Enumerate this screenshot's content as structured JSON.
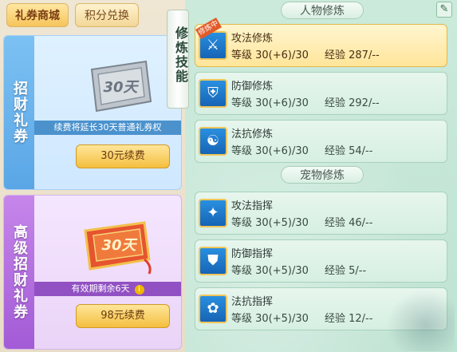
{
  "tabs": [
    {
      "label": "礼券商城",
      "active": true
    },
    {
      "label": "积分兑换",
      "active": false
    }
  ],
  "cards": [
    {
      "title": "招财礼券",
      "ticket_text": "30天",
      "note": "续费将延长30天普通礼券权",
      "button": "30元续费"
    },
    {
      "title": "高级招财礼券",
      "ticket_text": "30天",
      "note": "有效期剩余6天",
      "button": "98元续费"
    }
  ],
  "scroll_label": "修炼技能",
  "sections": {
    "character": "人物修炼",
    "pet": "宠物修炼"
  },
  "character_skills": [
    {
      "name": "攻法修炼",
      "level": "等级 30(+6)/30",
      "exp": "经验 287/--",
      "icon": "sword-icon",
      "badge": "修炼中",
      "active": true
    },
    {
      "name": "防御修炼",
      "level": "等级 30(+6)/30",
      "exp": "经验 292/--",
      "icon": "shield-icon",
      "active": false
    },
    {
      "name": "法抗修炼",
      "level": "等级 30(+6)/30",
      "exp": "经验 54/--",
      "icon": "taiji-icon",
      "active": false
    }
  ],
  "pet_skills": [
    {
      "name": "攻法指挥",
      "level": "等级 30(+5)/30",
      "exp": "经验 46/--",
      "icon": "claw-icon"
    },
    {
      "name": "防御指挥",
      "level": "等级 30(+5)/30",
      "exp": "经验 5/--",
      "icon": "paw-shield-icon"
    },
    {
      "name": "法抗指挥",
      "level": "等级 30(+5)/30",
      "exp": "经验 12/--",
      "icon": "paw-icon"
    }
  ]
}
